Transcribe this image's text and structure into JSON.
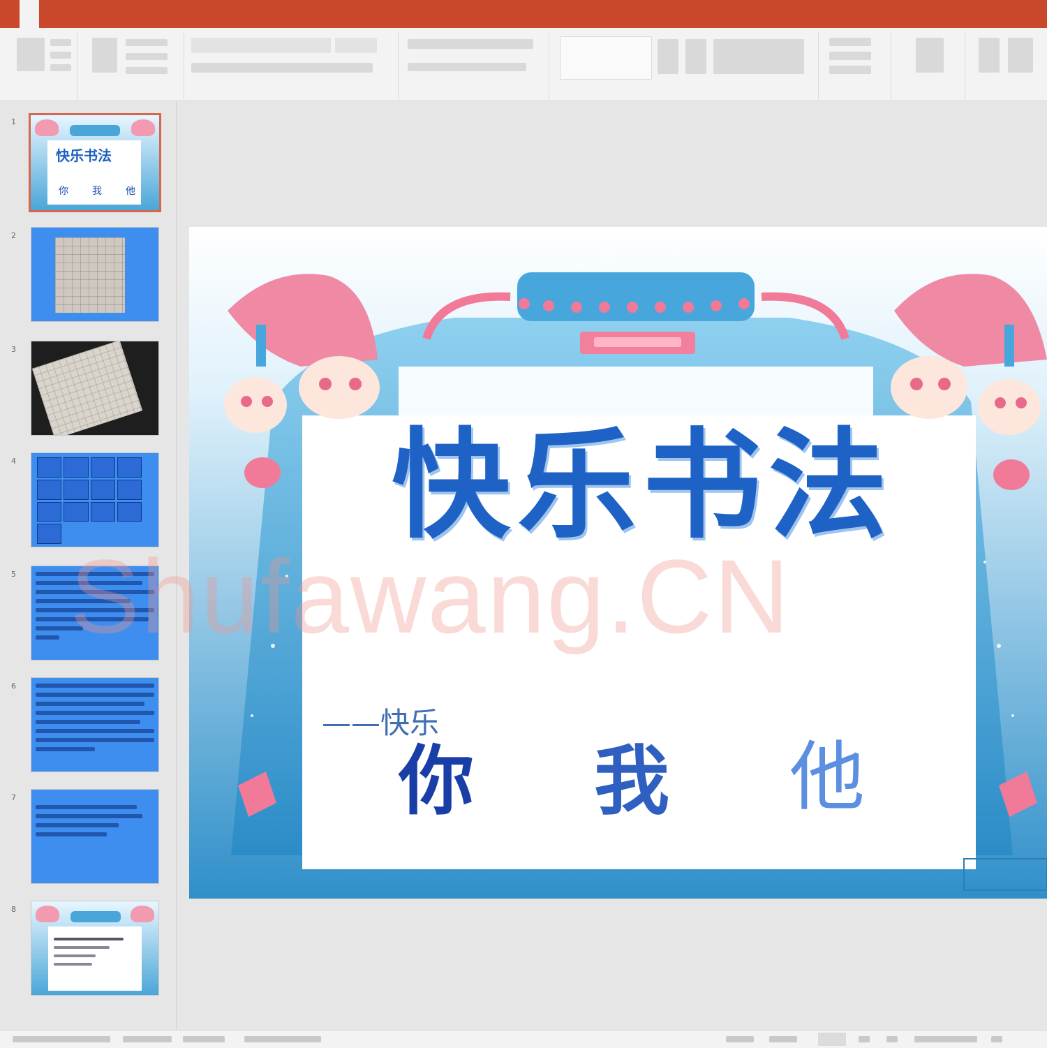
{
  "app": {
    "accent": "#c9482c",
    "window_title": ""
  },
  "menu_tabs": [],
  "ribbon": {
    "groups": [
      {
        "name": "clipboard-group"
      },
      {
        "name": "slides-group"
      },
      {
        "name": "font-group"
      },
      {
        "name": "paragraph-group"
      },
      {
        "name": "drawing-group"
      },
      {
        "name": "editing-group"
      },
      {
        "name": "dictate-group"
      },
      {
        "name": "designer-group"
      }
    ]
  },
  "thumbnails": [
    {
      "number": "1",
      "kind": "title-frame",
      "selected": true,
      "mini_title": "快乐书法",
      "mini_chars": [
        "你",
        "我",
        "他"
      ]
    },
    {
      "number": "2",
      "kind": "blue-grid-card"
    },
    {
      "number": "3",
      "kind": "dark-paper-photo"
    },
    {
      "number": "4",
      "kind": "blue-char-grid"
    },
    {
      "number": "5",
      "kind": "blue-text"
    },
    {
      "number": "6",
      "kind": "blue-text"
    },
    {
      "number": "7",
      "kind": "blue-text-short"
    },
    {
      "number": "8",
      "kind": "frame-text"
    }
  ],
  "slide": {
    "title": "快乐书法",
    "subtitle": "——快乐",
    "characters": [
      "你",
      "我",
      "他"
    ],
    "title_color": "#1d62c4",
    "frame_color": "#3aa0d6",
    "hat_color": "#f08aa4",
    "watermark": "Shufawang.CN"
  },
  "status": {
    "colors": {
      "bar": "#f3f3f3"
    }
  }
}
